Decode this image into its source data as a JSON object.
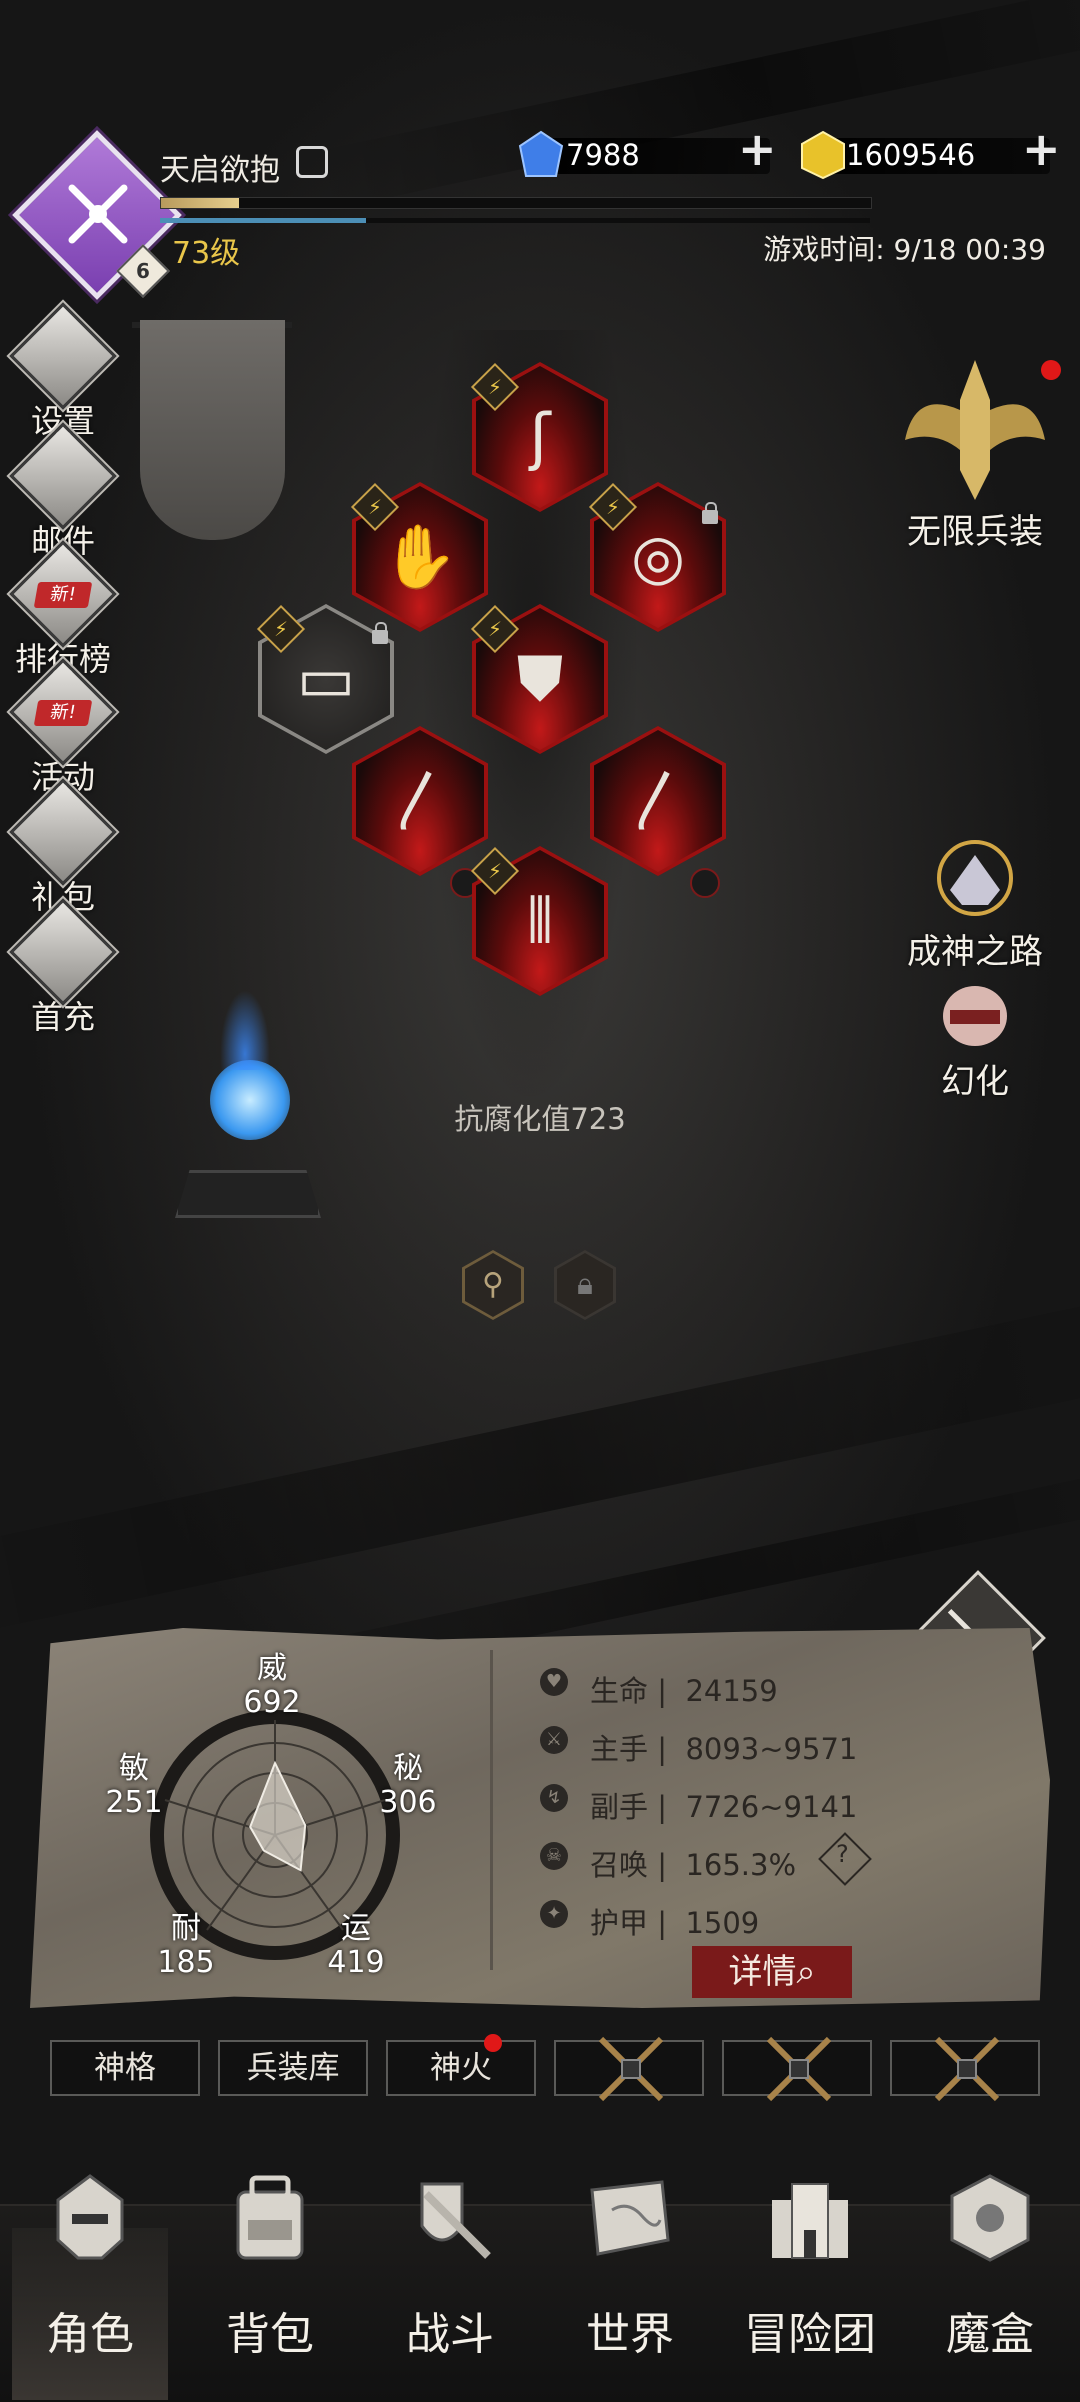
{
  "player": {
    "name": "天启欲抱",
    "level": "73级",
    "rank_badge": "6",
    "xp_progress": 0.11,
    "mana_progress": 0.29
  },
  "currency": {
    "gems": "7988",
    "gold": "1609546",
    "gem_color": "#3f7ee8",
    "gold_color": "#e8c22a"
  },
  "game_time": "游戏时间: 9/18 00:39",
  "side_menu": [
    {
      "label": "设置",
      "icon": "gear-icon"
    },
    {
      "label": "邮件",
      "icon": "mail-icon"
    },
    {
      "label": "排行榜",
      "icon": "ranking-icon",
      "tag": "新!"
    },
    {
      "label": "活动",
      "icon": "event-icon",
      "tag": "新!"
    },
    {
      "label": "礼包",
      "icon": "gift-icon"
    },
    {
      "label": "首充",
      "icon": "first-recharge-icon"
    }
  ],
  "right_menu": {
    "infinite_arms": "无限兵装",
    "godhood_path": "成神之路",
    "transform": "幻化"
  },
  "equipment": {
    "neck": "scarf-icon",
    "hand": "gauntlet-icon",
    "ring": "ring-icon",
    "belt": "belt-icon",
    "chest": "armor-icon",
    "main_weapon": "horn-blade-icon",
    "off_weapon": "horn-blade-icon",
    "legs": "greaves-icon"
  },
  "resistance": "抗腐化值723",
  "stats": {
    "wei": {
      "label": "威",
      "value": "692"
    },
    "mi": {
      "label": "秘",
      "value": "306"
    },
    "yun": {
      "label": "运",
      "value": "419"
    },
    "nai": {
      "label": "耐",
      "value": "185"
    },
    "min": {
      "label": "敏",
      "value": "251"
    }
  },
  "attributes": [
    {
      "label": "生命",
      "value": "24159",
      "icon": "heart-icon"
    },
    {
      "label": "主手",
      "value": "8093~9571",
      "icon": "sword-icon"
    },
    {
      "label": "副手",
      "value": "7726~9141",
      "icon": "offhand-icon"
    },
    {
      "label": "召唤",
      "value": "165.3%",
      "icon": "summon-icon"
    },
    {
      "label": "护甲",
      "value": "1509",
      "icon": "armor-stat-icon"
    }
  ],
  "details_button": "详情",
  "tabs": [
    "神格",
    "兵装库",
    "神火",
    "",
    "",
    ""
  ],
  "nav": [
    "角色",
    "背包",
    "战斗",
    "世界",
    "冒险团",
    "魔盒"
  ]
}
